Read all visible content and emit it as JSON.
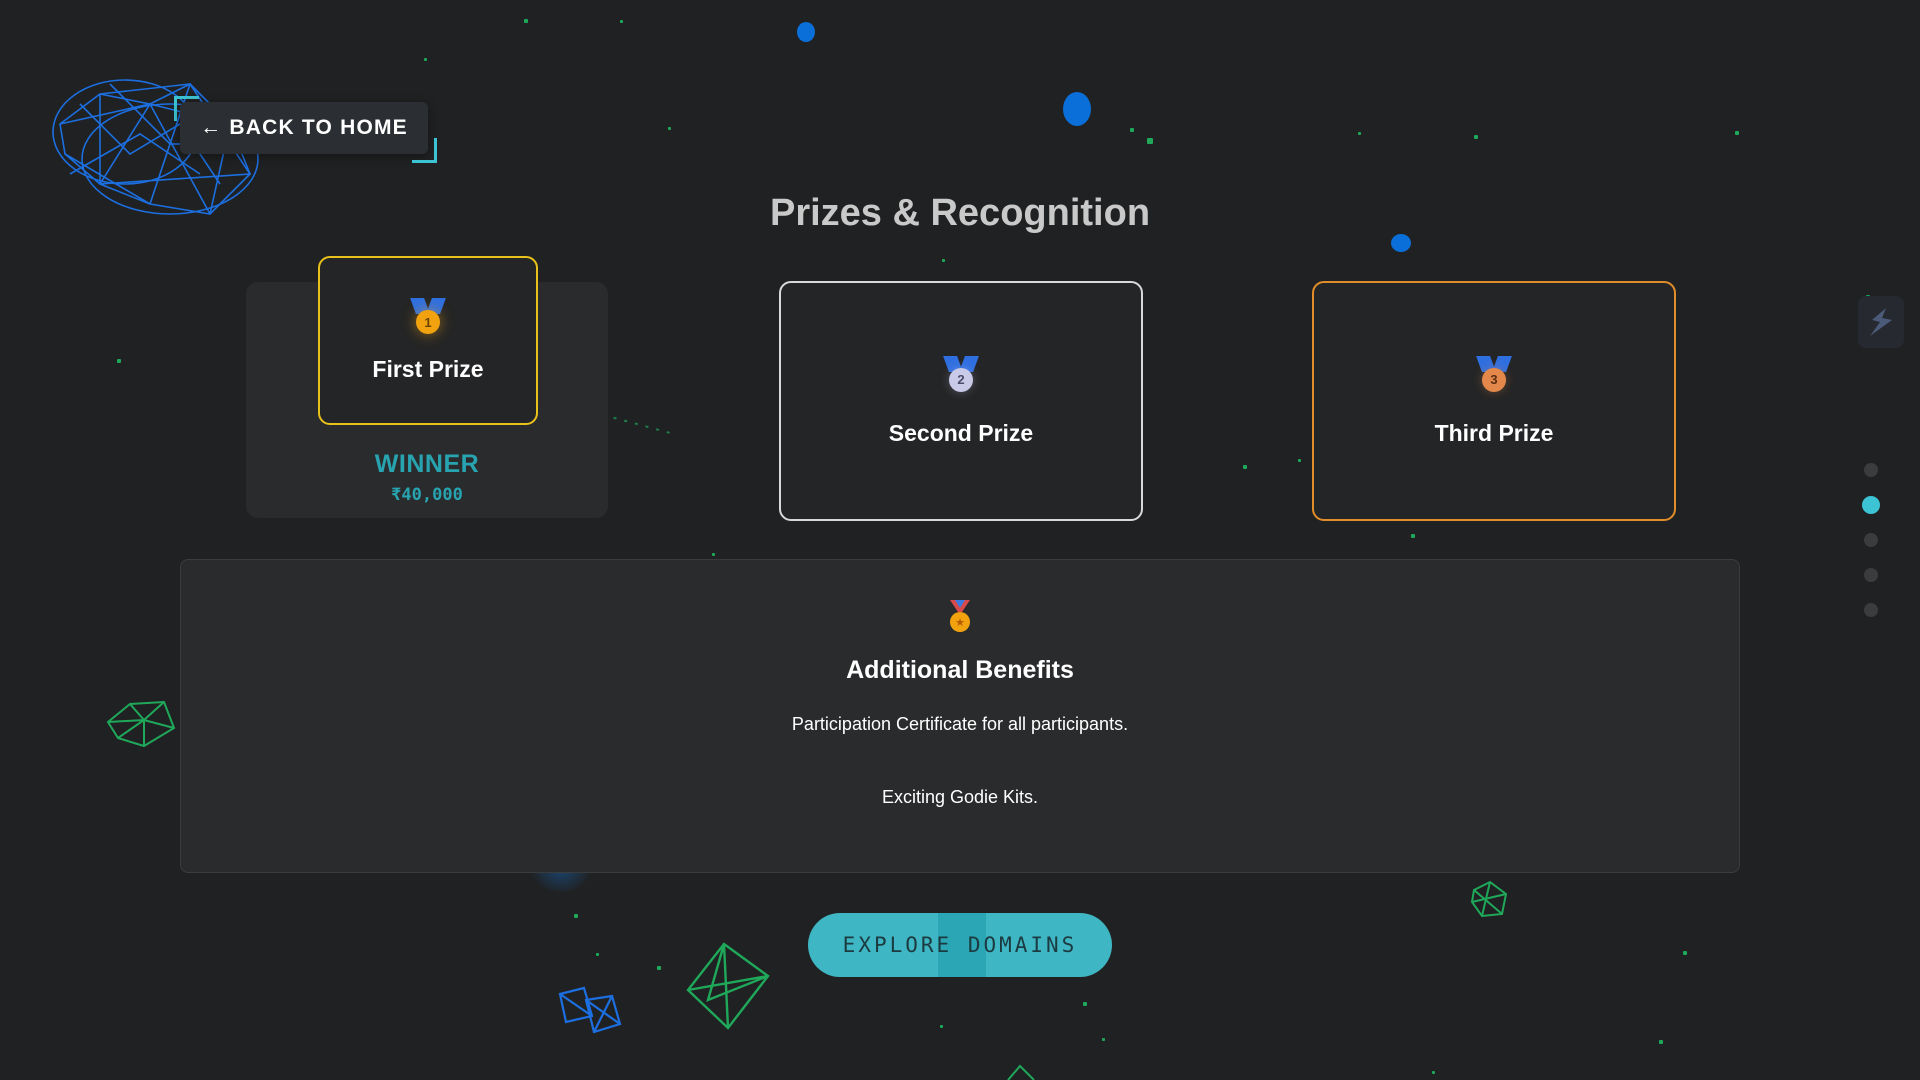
{
  "nav": {
    "back_label": "← BACK TO HOME"
  },
  "page": {
    "title": "Prizes & Recognition"
  },
  "prizes": [
    {
      "label": "First Prize",
      "medal_number": "1",
      "medal": "gold-medal-icon"
    },
    {
      "label": "Second Prize",
      "medal_number": "2",
      "medal": "silver-medal-icon"
    },
    {
      "label": "Third Prize",
      "medal_number": "3",
      "medal": "bronze-medal-icon"
    }
  ],
  "first_prize_detail": {
    "status": "WINNER",
    "amount": "₹40,000"
  },
  "benefits": {
    "icon": "sports-medal-icon",
    "title": "Additional Benefits",
    "items": [
      "Participation Certificate for all participants.",
      "Exciting Godie Kits."
    ]
  },
  "cta": {
    "label": "EXPLORE DOMAINS"
  },
  "side_nav": {
    "logo": "brand-logo-icon",
    "dots": 5,
    "active_index": 1
  },
  "colors": {
    "background": "#202122",
    "accent": "#3cc4d4",
    "gold": "#e8c21a",
    "silver": "#d9d9d9",
    "bronze": "#e08d2a",
    "winner_text": "#27a4b0"
  }
}
